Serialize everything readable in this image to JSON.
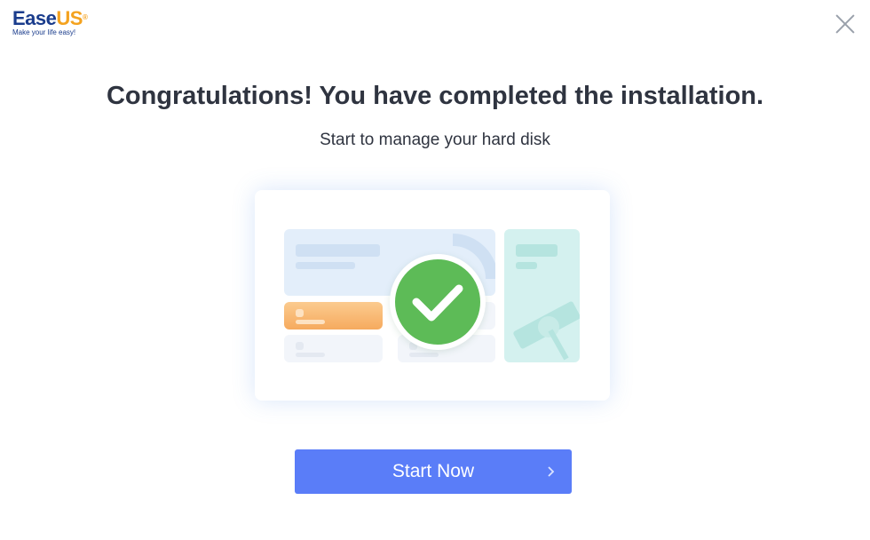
{
  "app": {
    "logo_main": "Ease",
    "logo_accent": "US",
    "logo_mark": "®",
    "logo_tagline": "Make your life easy!",
    "close_icon": "close-icon"
  },
  "main": {
    "title": "Congratulations! You have completed the installation.",
    "subtitle": "Start to manage your hard disk",
    "illustration_icon": "check-circle-icon"
  },
  "actions": {
    "start_label": "Start Now",
    "start_icon": "chevron-right-icon"
  },
  "colors": {
    "brand_primary": "#1a3c8c",
    "brand_accent": "#f4a21e",
    "button": "#5a7df8",
    "success": "#5dbb57",
    "text": "#2f3440"
  }
}
